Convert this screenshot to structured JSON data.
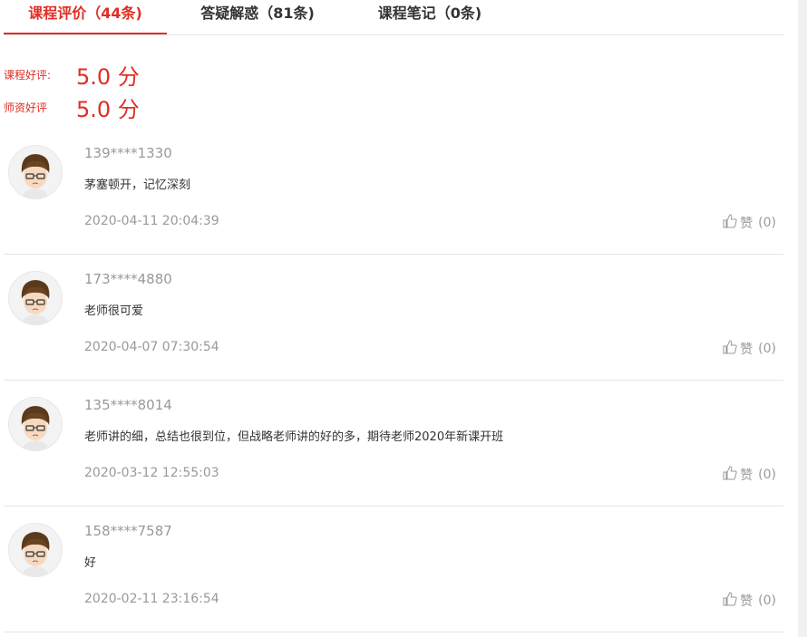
{
  "tabs": [
    {
      "label": "课程评价（44条)"
    },
    {
      "label": "答疑解惑（81条)"
    },
    {
      "label": "课程笔记（0条)"
    }
  ],
  "ratings": {
    "course_label": "课程好评:",
    "course_value": "5.0 分",
    "teacher_label": "师资好评",
    "teacher_value": "5.0 分"
  },
  "reviews": [
    {
      "user": "139****1330",
      "comment": "茅塞顿开，记忆深刻",
      "date": "2020-04-11 20:04:39",
      "like_label": "赞",
      "like_count": "(0)"
    },
    {
      "user": "173****4880",
      "comment": "老师很可爱",
      "date": "2020-04-07 07:30:54",
      "like_label": "赞",
      "like_count": "(0)"
    },
    {
      "user": "135****8014",
      "comment": "老师讲的细，总结也很到位，但战略老师讲的好的多，期待老师2020年新课开班",
      "date": "2020-03-12 12:55:03",
      "like_label": "赞",
      "like_count": "(0)"
    },
    {
      "user": "158****7587",
      "comment": "好",
      "date": "2020-02-11 23:16:54",
      "like_label": "赞",
      "like_count": "(0)"
    }
  ],
  "colors": {
    "accent": "#e02e24",
    "muted": "#999999",
    "divider": "#e5e5e5"
  }
}
